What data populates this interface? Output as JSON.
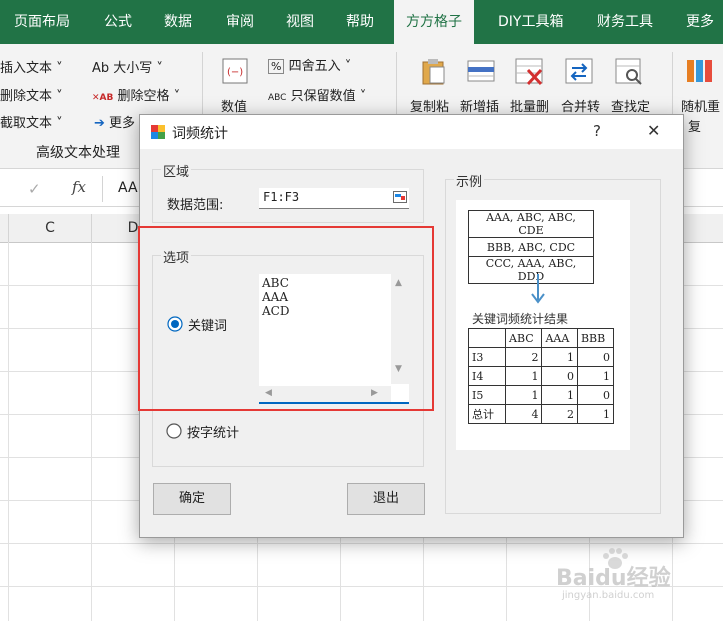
{
  "ribbon_tabs": [
    "页面布局",
    "公式",
    "数据",
    "审阅",
    "视图",
    "帮助",
    "方方格子",
    "DIY工具箱",
    "财务工具",
    "更多"
  ],
  "ribbon": {
    "left_items": [
      "插入文本",
      "删除文本",
      "截取文本"
    ],
    "ab_case": "Ab 大小写",
    "remove_space": "删除空格",
    "more": "更多",
    "group_label": "高级文本处理",
    "numeric_label": "数值",
    "round_label": "四舍五入",
    "keep_value_label": "只保留数值",
    "big_buttons": [
      "复制粘",
      "新增插",
      "批量删",
      "合并转",
      "查找定"
    ],
    "random_label": "随机重",
    "random_label2": "复"
  },
  "formula_bar": {
    "check": "✓",
    "fx": "fx",
    "value": "AA"
  },
  "columns": [
    "C",
    "D"
  ],
  "dialog": {
    "title": "词频统计",
    "help": "?",
    "close": "✕",
    "region_legend": "区域",
    "range_label": "数据范围:",
    "range_value": "F1:F3",
    "options_legend": "选项",
    "radio_keyword": "关键词",
    "radio_char": "按字统计",
    "keywords": "ABC\nAAA\nACD",
    "ok": "确定",
    "exit": "退出",
    "example_legend": "示例",
    "example_src": [
      "AAA, ABC, ABC, CDE",
      "BBB, ABC, CDC",
      "CCC, AAA, ABC, DDD"
    ],
    "result_title": "关键词频统计结果",
    "result_headers": [
      "",
      "ABC",
      "AAA",
      "BBB"
    ],
    "result_rows": [
      [
        "I3",
        "2",
        "1",
        "0"
      ],
      [
        "I4",
        "1",
        "0",
        "1"
      ],
      [
        "I5",
        "1",
        "1",
        "0"
      ],
      [
        "总计",
        "4",
        "2",
        "1"
      ]
    ]
  },
  "watermark": {
    "brand": "Baidu经验",
    "sub": "jingyan.baidu.com"
  },
  "colors": {
    "excel_green": "#217346",
    "accent_red": "#e53935",
    "radio_blue": "#0067c0"
  }
}
